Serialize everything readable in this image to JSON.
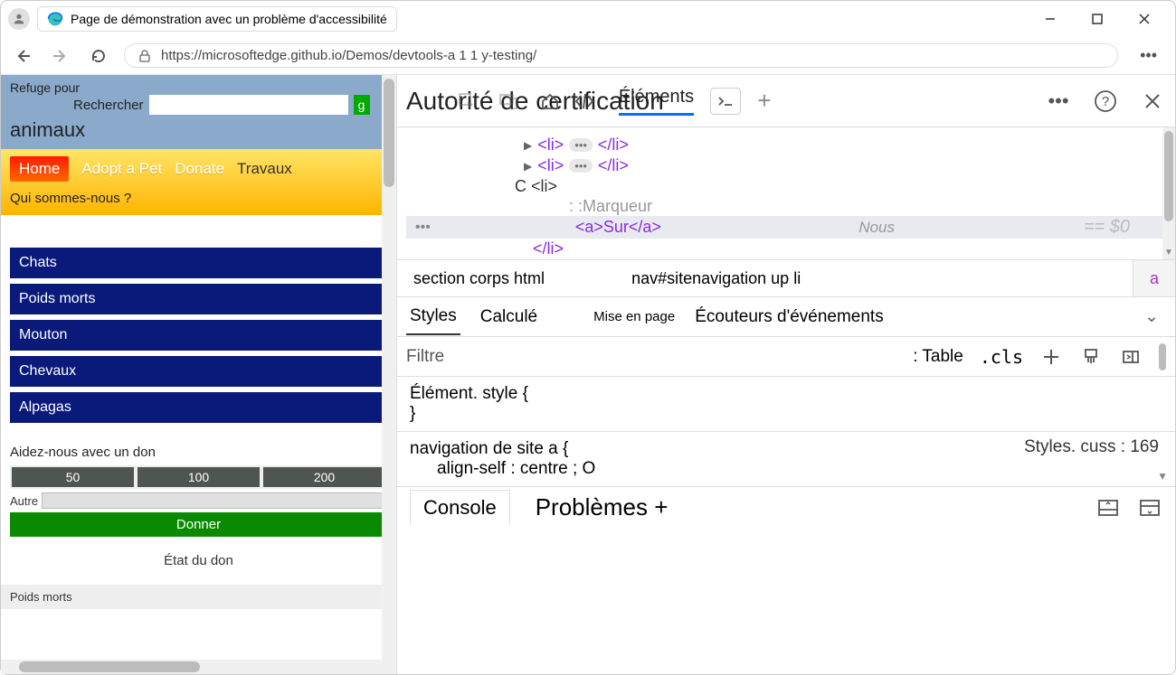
{
  "browser": {
    "tab_title": "Page de démonstration avec un problème d'accessibilité",
    "url": "https://microsoftedge.github.io/Demos/devtools-a 1 1 y-testing/"
  },
  "page": {
    "refuge": "Refuge pour",
    "search_label": "Rechercher",
    "search_go": "g",
    "animals": "animaux",
    "nav": {
      "home": "Home",
      "adopt": "Adopt a Pet",
      "donate": "Donate",
      "travaux": "Travaux",
      "about": "Qui sommes-nous ?"
    },
    "categories": [
      "Chats",
      "Poids morts",
      "Mouton",
      "Chevaux",
      "Alpagas"
    ],
    "donation": {
      "title": "Aidez-nous avec un don",
      "amounts": [
        "50",
        "100",
        "200"
      ],
      "other_label": "Autre",
      "submit": "Donner",
      "status": "État du don"
    },
    "footer_label": "Poids morts"
  },
  "devtools": {
    "title": "Autorité de certification",
    "elements_tab": "Éléments",
    "dom": {
      "li_open": "<li>",
      "li_close": "</li>",
      "c_li": "C <li>",
      "marker": ": :Marqueur",
      "a_sur": "<a>Sur</a>",
      "nous": "Nous",
      "eq0": "== $0",
      "close_li": "</li>"
    },
    "breadcrumb": {
      "left": "section corps html",
      "mid": "nav#sitenavigation up li",
      "last": "a"
    },
    "styles_tabs": {
      "styles": "Styles",
      "computed": "Calculé",
      "layout": "Mise en page",
      "listeners": "Écouteurs d'événements"
    },
    "filter": {
      "placeholder": "Filtre",
      "table": ": Table",
      "cls": ".cls"
    },
    "style_body": {
      "element_style_open": "Élément. style {",
      "close": "}",
      "rule": "navigation de site a {",
      "prop": "align-self : centre ; O",
      "source": "Styles. cuss : 169"
    },
    "drawer": {
      "console": "Console",
      "problems": "Problèmes +"
    }
  }
}
